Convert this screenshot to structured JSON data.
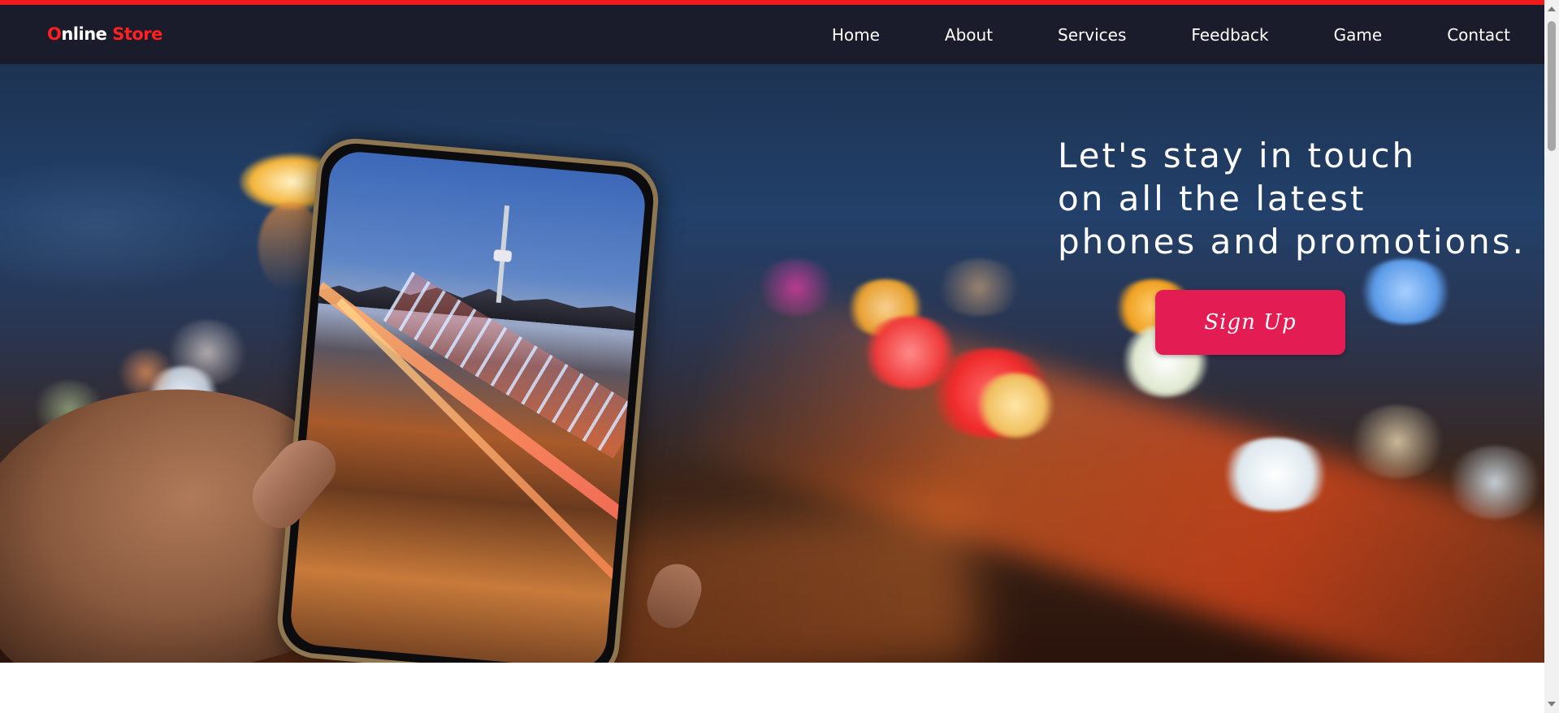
{
  "brand": {
    "first_letter": "O",
    "middle": "nline",
    "last": " Store"
  },
  "nav": {
    "items": [
      {
        "label": "Home"
      },
      {
        "label": "About"
      },
      {
        "label": "Services"
      },
      {
        "label": "Feedback"
      },
      {
        "label": "Game"
      },
      {
        "label": "Contact"
      }
    ]
  },
  "hero": {
    "tagline_lines": [
      "Let's stay in touch",
      "on all the latest",
      "phones and promotions."
    ],
    "signup_label": "Sign Up",
    "background_image": "blurred city traffic lights with hand holding phone"
  },
  "colors": {
    "accent_red": "#ef1a1a",
    "navbar_bg": "#1b1c2b",
    "button_pink": "#e31c54"
  }
}
